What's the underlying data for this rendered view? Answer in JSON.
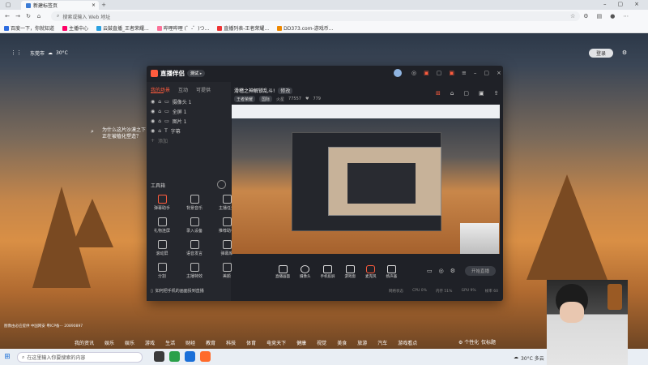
{
  "browser": {
    "tab_title": "新建标签页",
    "url_placeholder": "搜索或输入 Web 地址",
    "favorites": [
      "百度一下，你就知道",
      "主播中心",
      "云鼓直播_王者荣耀...",
      "哔哩哔哩 (゜-゜)つ...",
      "直播列表-王者荣耀...",
      "DD373.com-游戏币..."
    ]
  },
  "ntp": {
    "city": "东莞市",
    "temp": "30°C",
    "login": "登录",
    "search_hint_1": "为什么这片沙漠之下",
    "search_hint_2": "正在被植化塑造？",
    "footer": "图像由必应提供 中国网安 粤ICP备··· 20890897",
    "news_tabs": [
      "我的资讯",
      "娱乐",
      "娱乐",
      "游戏",
      "生活",
      "财经",
      "教育",
      "科技",
      "体育",
      "电竞天下",
      "健康",
      "视觉",
      "美食",
      "旅游",
      "汽车",
      "游戏看点"
    ],
    "personalize": "个性化",
    "more": "仅标题"
  },
  "taskbar": {
    "search_placeholder": "在这里输入你要搜索的内容",
    "weather": "30°C 多云"
  },
  "app": {
    "title": "直播伴侣",
    "version": "测试",
    "left_tabs": [
      "我的场景",
      "互动",
      "可提供"
    ],
    "sources": [
      "摄像头 1",
      "全屏 1",
      "图片 1",
      "字幕"
    ],
    "add_source": "添加",
    "tools_title": "工具箱",
    "tools": [
      {
        "label": "弹幕助手"
      },
      {
        "label": "背景音乐"
      },
      {
        "label": "主播任务"
      },
      {
        "label": "礼物连屏"
      },
      {
        "label": "录入设备"
      },
      {
        "label": "推荐助手"
      },
      {
        "label": "滚动屏"
      },
      {
        "label": "语音发言"
      },
      {
        "label": "弹幕库"
      },
      {
        "label": "分割"
      },
      {
        "label": "主播特效"
      },
      {
        "label": "美颜"
      }
    ],
    "phone_hint": "如何把手机的画面投到直播",
    "headline": "滑稽之神解锁乱斗!",
    "headline_chip": "修改",
    "game_tag": "王者荣耀",
    "status_chip": "国际",
    "viewers_label": "火星",
    "viewers": "77557",
    "likes": "779",
    "controls": [
      "直播画面",
      "摄像头",
      "手机投屏",
      "游戏窗",
      "麦克风",
      "扬声器"
    ],
    "start_button": "开始直播",
    "stats": [
      "网络状态",
      "CPU 0%",
      "内存 51%",
      "GPU 9%",
      "帧率 60"
    ]
  },
  "colors": {
    "accent": "#ff5c3e",
    "app_bg": "#1f2127",
    "taskbar_bg": "#e9eef4"
  }
}
